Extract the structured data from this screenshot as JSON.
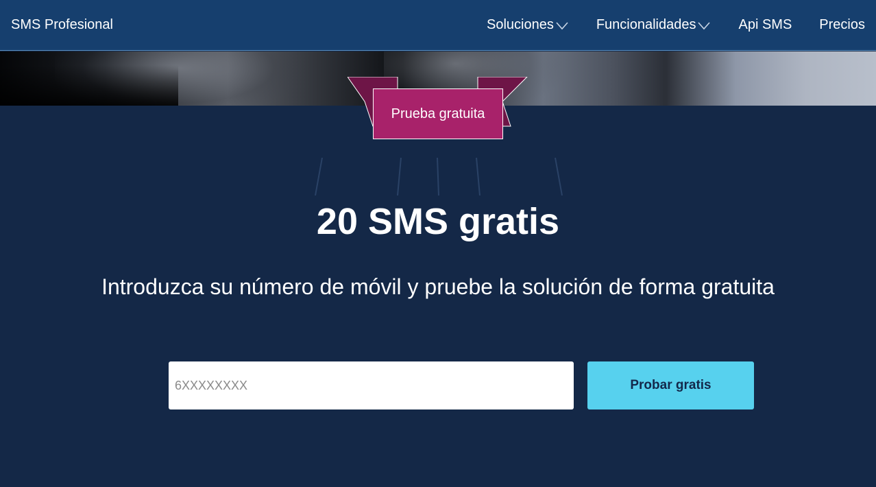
{
  "header": {
    "brand": "SMS Profesional",
    "nav": [
      {
        "label": "Soluciones",
        "icon": "chevron-down-icon"
      },
      {
        "label": "Funcionalidades",
        "icon": "chevron-down-icon"
      },
      {
        "label": "Api SMS"
      },
      {
        "label": "Precios"
      }
    ]
  },
  "ribbon": {
    "label": "Prueba gratuita"
  },
  "hero": {
    "title": "20 SMS gratis",
    "subtitle": "Introduzca su número de móvil y pruebe la solución de forma gratuita"
  },
  "form": {
    "phone_placeholder": "6XXXXXXXX",
    "phone_value": "",
    "submit_label": "Probar gratis"
  },
  "colors": {
    "header_bg": "#163f6e",
    "page_bg": "#142847",
    "ribbon_front": "#a8226a",
    "ribbon_back": "#6e1547",
    "button_bg": "#57d1ee",
    "button_text": "#13284a"
  }
}
